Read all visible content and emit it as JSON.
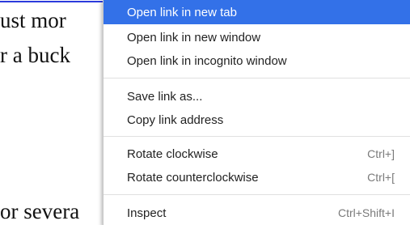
{
  "background": {
    "lines": [
      "ust mor",
      "r a buck",
      "or severa"
    ]
  },
  "menu": {
    "items": [
      {
        "label": "Open link in new tab",
        "shortcut": ""
      },
      {
        "label": "Open link in new window",
        "shortcut": ""
      },
      {
        "label": "Open link in incognito window",
        "shortcut": ""
      },
      {
        "label": "Save link as...",
        "shortcut": ""
      },
      {
        "label": "Copy link address",
        "shortcut": ""
      },
      {
        "label": "Rotate clockwise",
        "shortcut": "Ctrl+]"
      },
      {
        "label": "Rotate counterclockwise",
        "shortcut": "Ctrl+["
      },
      {
        "label": "Inspect",
        "shortcut": "Ctrl+Shift+I"
      }
    ],
    "highlight_color": "#3371e8"
  }
}
